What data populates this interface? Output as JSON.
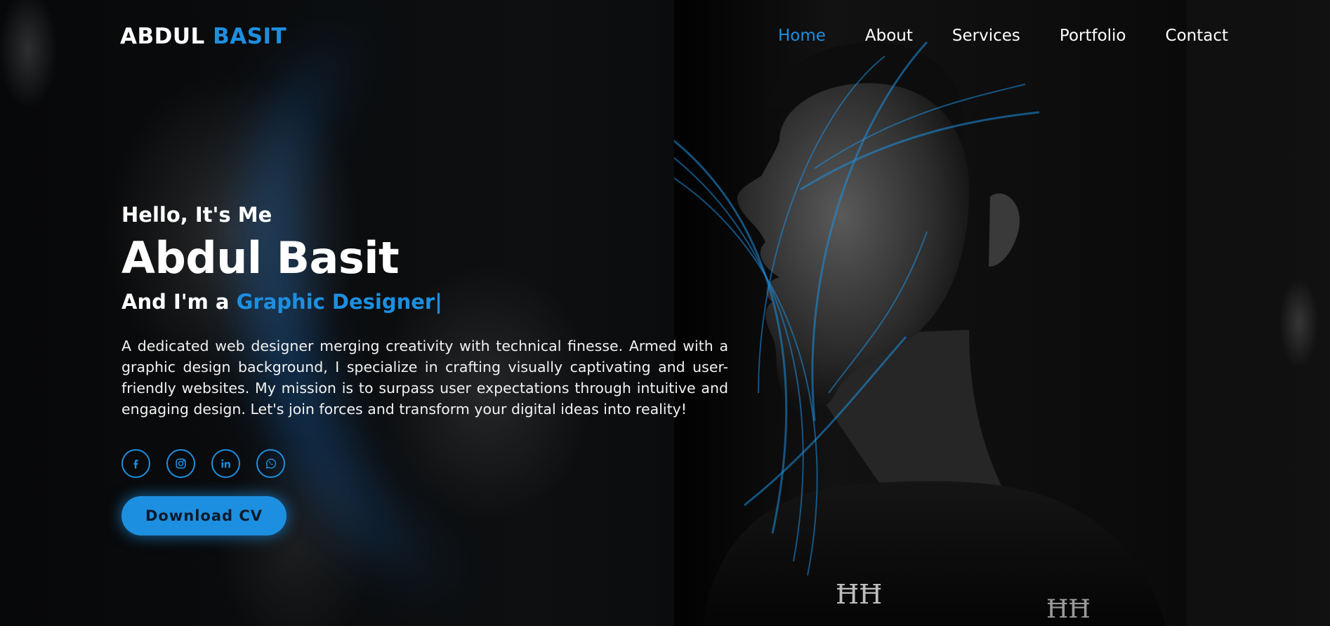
{
  "brand": {
    "first": "ABDUL",
    "last": "BASIT",
    "accent_color": "#1d8fe0"
  },
  "nav": {
    "items": [
      {
        "label": "Home",
        "active": true
      },
      {
        "label": "About",
        "active": false
      },
      {
        "label": "Services",
        "active": false
      },
      {
        "label": "Portfolio",
        "active": false
      },
      {
        "label": "Contact",
        "active": false
      }
    ]
  },
  "hero": {
    "greeting": "Hello, It's Me",
    "name": "Abdul Basit",
    "role_prefix": "And I'm a",
    "role": "Graphic Designer",
    "cursor": "|",
    "description": "A dedicated web designer merging creativity with technical finesse. Armed with a graphic design background, I specialize in crafting visually captivating and user-friendly websites. My mission is to surpass user expectations through intuitive and engaging design. Let's join forces and transform your digital ideas into reality!",
    "socials": [
      {
        "icon": "facebook-icon"
      },
      {
        "icon": "instagram-icon"
      },
      {
        "icon": "linkedin-icon"
      },
      {
        "icon": "whatsapp-icon"
      }
    ],
    "cta_label": "Download CV"
  }
}
